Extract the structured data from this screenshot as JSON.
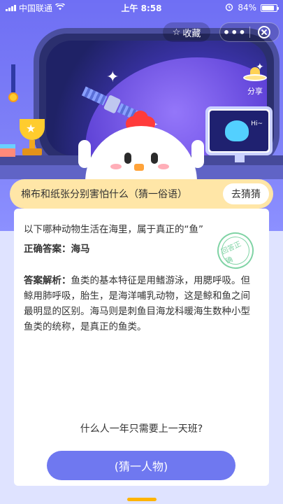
{
  "status_bar": {
    "carrier": "中国联通",
    "time": "上午 8:58",
    "battery": "84%",
    "battery_level": 0.84
  },
  "header": {
    "favorite_label": "收藏",
    "more_label": "•••",
    "share_label": "分享"
  },
  "scene": {
    "monitor_text": "Hi~"
  },
  "riddle": {
    "text": "棉布和纸张分别害怕什么（猜一俗语）",
    "button_label": "去猜猜"
  },
  "answer_card": {
    "question": "以下哪种动物生活在海里，属于真正的“鱼”",
    "answer_label": "正确答案：",
    "answer_value": "海马",
    "stamp_text": "回答正确",
    "explanation_label": "答案解析：",
    "explanation_text": "鱼类的基本特征是用鳍游泳，用腮呼吸。但鲸用肺呼吸，胎生，是海洋哺乳动物，这是鲸和鱼之间最明显的区别。海马则是刺鱼目海龙科暖海生数种小型鱼类的统称，是真正的鱼类。"
  },
  "next_riddle": {
    "text": "什么人一年只需要上一天班?",
    "button_label": "(猜一人物)"
  },
  "colors": {
    "accent": "#6f78f0",
    "banner": "#ffe6a7",
    "scene_bg": "#7d7ff7",
    "stamp": "#61c98f"
  }
}
